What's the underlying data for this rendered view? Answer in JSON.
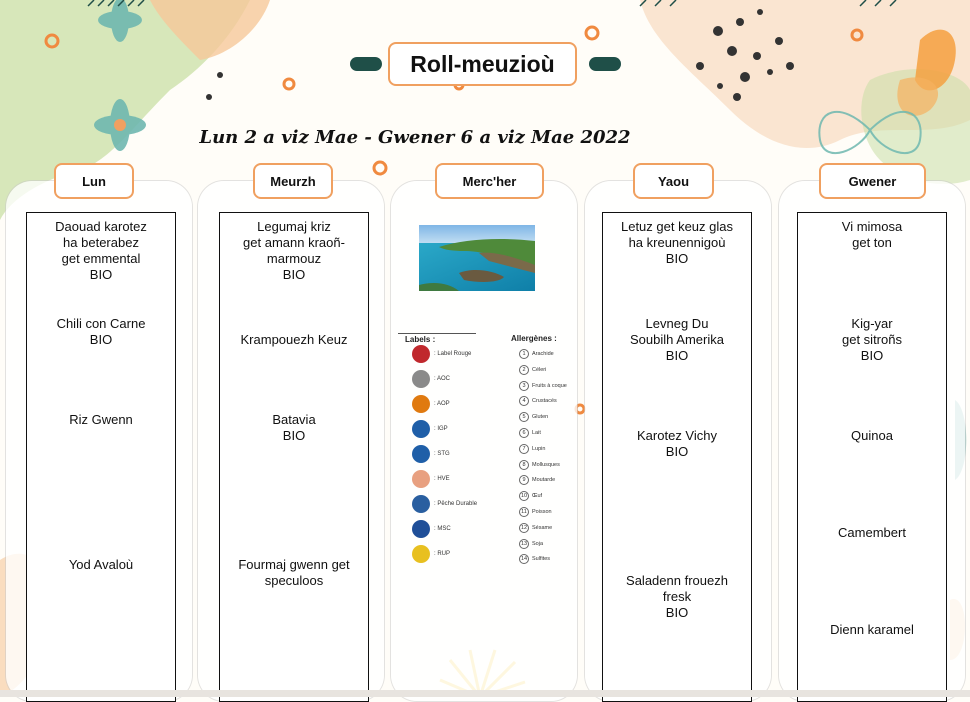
{
  "header": {
    "title": "Roll-meuzioù",
    "dates": "Lun 2 a viz Mae - Gwener 6 a viz Mae 2022"
  },
  "days": [
    {
      "name": "Lun",
      "items": [
        {
          "text": "Daouad karotez\nha beterabez\nget emmental\nBIO"
        },
        {
          "text": "Chili con Carne\nBIO"
        },
        {
          "text": "Riz Gwenn"
        },
        {
          "text": "Yod Avaloù"
        }
      ]
    },
    {
      "name": "Meurzh",
      "items": [
        {
          "text": "Legumaj kriz\nget amann kraoñ-\nmarmouz\nBIO"
        },
        {
          "text": "Krampouezh Keuz"
        },
        {
          "text": "Batavia\nBIO"
        },
        {
          "text": "Fourmaj gwenn get\nspeculoos"
        }
      ]
    },
    {
      "name": "Merc'her",
      "items": []
    },
    {
      "name": "Yaou",
      "items": [
        {
          "text": "Letuz get keuz glas\nha kreunennigoù\nBIO"
        },
        {
          "text": "Levneg Du\nSoubilh Amerika\nBIO"
        },
        {
          "text": "Karotez Vichy\nBIO"
        },
        {
          "text": "Saladenn frouezh\nfresk\nBIO"
        }
      ]
    },
    {
      "name": "Gwener",
      "items": [
        {
          "text": "Vi mimosa\nget ton"
        },
        {
          "text": "Kig-yar\nget sitroñs\nBIO"
        },
        {
          "text": "Quinoa"
        },
        {
          "text": "Camembert"
        },
        {
          "text": "Dienn karamel"
        }
      ]
    }
  ],
  "legend": {
    "labels_title": "Labels :",
    "labels": [
      {
        "name": ": Label Rouge",
        "color": "#c0282d",
        "icon": "label-rouge-icon"
      },
      {
        "name": ": AOC",
        "color": "#8a8a8a",
        "icon": "aoc-icon"
      },
      {
        "name": ": AOP",
        "color": "#e07a10",
        "icon": "aop-icon"
      },
      {
        "name": ": IGP",
        "color": "#1f5fa8",
        "icon": "igp-icon"
      },
      {
        "name": ": STG",
        "color": "#1f5fa8",
        "icon": "stg-icon"
      },
      {
        "name": ": HVE",
        "color": "#e8a080",
        "icon": "hve-icon"
      },
      {
        "name": ": Pêche Durable",
        "color": "#2a5fa0",
        "icon": "peche-durable-icon"
      },
      {
        "name": ": MSC",
        "color": "#1f4f98",
        "icon": "msc-icon"
      },
      {
        "name": ": RUP",
        "color": "#e8c020",
        "icon": "rup-icon"
      }
    ],
    "allergens_title": "Allergènes :",
    "allergens": [
      {
        "num": "1",
        "name": "Arachide"
      },
      {
        "num": "2",
        "name": "Céleri"
      },
      {
        "num": "3",
        "name": "Fruits à coque"
      },
      {
        "num": "4",
        "name": "Crustacés"
      },
      {
        "num": "5",
        "name": "Gluten"
      },
      {
        "num": "6",
        "name": "Lait"
      },
      {
        "num": "7",
        "name": "Lupin"
      },
      {
        "num": "8",
        "name": "Mollusques"
      },
      {
        "num": "9",
        "name": "Moutarde"
      },
      {
        "num": "10",
        "name": "Œuf"
      },
      {
        "num": "11",
        "name": "Poisson"
      },
      {
        "num": "12",
        "name": "Sésame"
      },
      {
        "num": "13",
        "name": "Soja"
      },
      {
        "num": "14",
        "name": "Sulfites"
      }
    ]
  }
}
